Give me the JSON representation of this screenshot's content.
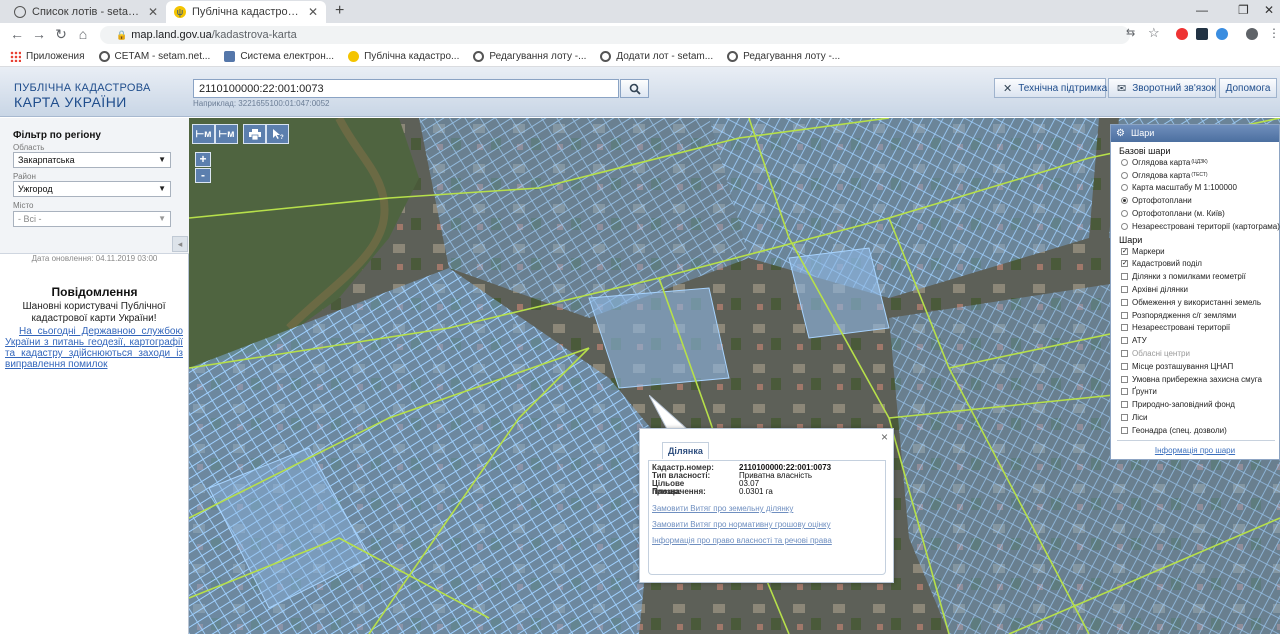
{
  "browser": {
    "tabs": [
      {
        "title": "Список лотів - setam.net.ua",
        "active": false
      },
      {
        "title": "Публічна кадастрова карта Укр...",
        "active": true
      }
    ],
    "new_tab": "+",
    "url_host": "map.land.gov.ua",
    "url_path": "/kadastrova-karta",
    "bookmarks": [
      {
        "label": "Приложения",
        "icon": "apps-grid-icon"
      },
      {
        "label": "СЕТАМ - setam.net...",
        "icon": "setam-icon"
      },
      {
        "label": "Система електрон...",
        "icon": "system-icon"
      },
      {
        "label": "Публічна кадастро...",
        "icon": "ukraine-crest-icon"
      },
      {
        "label": "Редагування лоту -...",
        "icon": "setam-icon"
      },
      {
        "label": "Додати лот - setam...",
        "icon": "setam-icon"
      },
      {
        "label": "Редагування лоту -...",
        "icon": "setam-icon"
      }
    ]
  },
  "header": {
    "logo_line1": "ПУБЛІЧНА КАДАСТРОВА",
    "logo_line2": "КАРТА УКРАЇНИ",
    "search_value": "2110100000:22:001:0073",
    "search_example": "Наприклад: 3221655100:01:047:0052",
    "buttons": {
      "support": "Технічна підтримка",
      "feedback": "Зворотний зв'язок",
      "help": "Допомога"
    }
  },
  "sidebar": {
    "filter_title": "Фільтр по регіону",
    "oblast_label": "Область",
    "oblast_value": "Закарпатська",
    "raion_label": "Район",
    "raion_value": "Ужгород",
    "city_label": "Місто",
    "city_value": "- Всі -",
    "updated": "Дата оновлення: 04.11.2019 03:00",
    "notice_title": "Повідомлення",
    "notice_greeting": "Шановні користувачі Публічної кадастрової карти України!",
    "notice_body": "На сьогодні Державною службою України з питань геодезії, картографії та кадастру здійснюються заходи із виправлення помилок"
  },
  "map_tools": {
    "measure_length": "⊢м",
    "measure_area": "⊢м",
    "print": "print-icon",
    "identify": "cursor-question-icon",
    "zoom_in": "+",
    "zoom_out": "-"
  },
  "layers": {
    "title": "Шари",
    "base_title": "Базові шари",
    "base": [
      {
        "label": "Оглядова карта",
        "sup": "(ЦДЗК)",
        "checked": false
      },
      {
        "label": "Оглядова карта",
        "sup": "(ТЕСТ)",
        "checked": false
      },
      {
        "label": "Карта масштабу М 1:100000",
        "sup": "",
        "checked": false
      },
      {
        "label": "Ортофотоплани",
        "sup": "",
        "checked": true
      },
      {
        "label": "Ортофотоплани (м. Київ)",
        "sup": "",
        "checked": false
      },
      {
        "label": "Незареєстровані території (картограма)",
        "sup": "",
        "checked": false
      }
    ],
    "overlay_title": "Шари",
    "overlays": [
      {
        "label": "Маркери",
        "checked": true,
        "disabled": false
      },
      {
        "label": "Кадастровий поділ",
        "checked": true,
        "disabled": false
      },
      {
        "label": "Ділянки з помилками геометрії",
        "checked": false,
        "disabled": false
      },
      {
        "label": "Архівні ділянки",
        "checked": false,
        "disabled": false
      },
      {
        "label": "Обмеження у використанні земель",
        "checked": false,
        "disabled": false
      },
      {
        "label": "Розпорядження с/г землями",
        "checked": false,
        "disabled": false
      },
      {
        "label": "Незареєстровані території",
        "checked": false,
        "disabled": false
      },
      {
        "label": "АТУ",
        "checked": false,
        "disabled": false
      },
      {
        "label": "Обласні центри",
        "checked": false,
        "disabled": true
      },
      {
        "label": "Місце розташування ЦНАП",
        "checked": false,
        "disabled": false
      },
      {
        "label": "Умовна прибережна захисна смуга",
        "checked": false,
        "disabled": false
      },
      {
        "label": "Ґрунти",
        "checked": false,
        "disabled": false
      },
      {
        "label": "Природно-заповідний фонд",
        "checked": false,
        "disabled": false
      },
      {
        "label": "Ліси",
        "checked": false,
        "disabled": false
      },
      {
        "label": "Геонадра (спец. дозволи)",
        "checked": false,
        "disabled": false
      }
    ],
    "info_link": "Інформація про шари"
  },
  "popup": {
    "tab": "Ділянка",
    "rows": [
      {
        "key": "Кадастр.номер:",
        "value": "2110100000:22:001:0073",
        "bold": true
      },
      {
        "key": "Тип власності:",
        "value": "Приватна власність",
        "bold": false
      },
      {
        "key": "Цільове призначення:",
        "value": "03.07",
        "bold": false
      },
      {
        "key": "Площа:",
        "value": "0.0301 га",
        "bold": false
      }
    ],
    "links": [
      "Замовити Витяг про земельну ділянку",
      "Замовити Витяг про нормативну грошову оцінку",
      "Інформація про право власності та речові права"
    ],
    "close": "×"
  },
  "colors": {
    "header_blue": "#1f4d8c",
    "parcel_fill": "#7fb3e8",
    "parcel_stroke": "#8fc4f5",
    "boundary_green": "#b7e04a",
    "link_blue": "#3366bb"
  }
}
